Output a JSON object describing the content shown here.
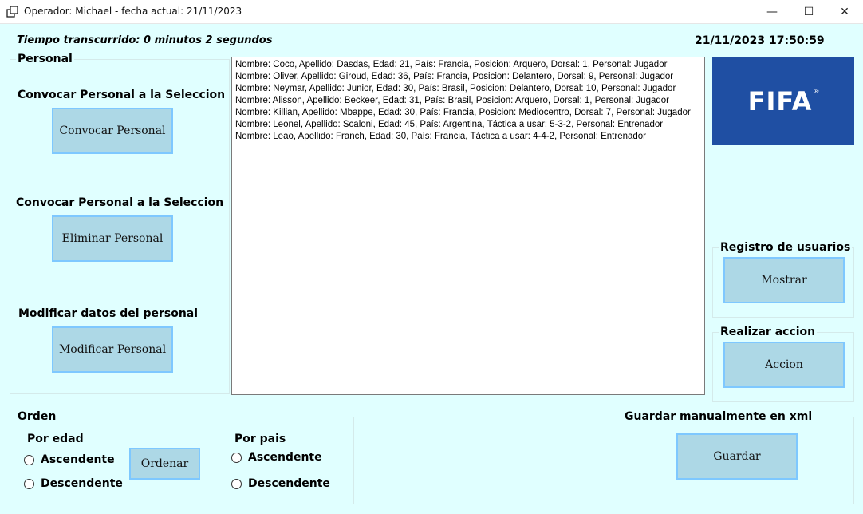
{
  "window": {
    "title": "Operador: Michael - fecha actual: 21/11/2023",
    "minimize": "—",
    "maximize": "☐",
    "close": "✕"
  },
  "header": {
    "elapsed": "Tiempo transcurrido: 0 minutos 2 segundos",
    "clock": "21/11/2023 17:50:59"
  },
  "personal": {
    "group_title": "Personal",
    "convocar_heading": "Convocar Personal a la Seleccion",
    "convocar_button": "Convocar Personal",
    "eliminar_heading": "Convocar Personal a la Seleccion",
    "eliminar_button": "Eliminar Personal",
    "modificar_heading": "Modificar datos del personal",
    "modificar_button": "Modificar Personal"
  },
  "list": {
    "items": [
      "Nombre: Coco, Apellido: Dasdas, Edad: 21, País: Francia, Posicion: Arquero, Dorsal: 1, Personal: Jugador",
      "Nombre: Oliver, Apellido: Giroud, Edad: 36, País: Francia, Posicion: Delantero, Dorsal: 9, Personal: Jugador",
      "Nombre: Neymar, Apellido: Junior, Edad: 30, País: Brasil, Posicion: Delantero, Dorsal: 10, Personal: Jugador",
      "Nombre: Alisson, Apellido: Beckeer, Edad: 31, País: Brasil, Posicion: Arquero, Dorsal: 1, Personal: Jugador",
      "Nombre: Killian, Apellido: Mbappe, Edad: 30, País: Francia, Posicion: Mediocentro, Dorsal: 7, Personal: Jugador",
      "Nombre: Leonel, Apellido: Scaloni, Edad: 45, País: Argentina, Táctica a usar: 5-3-2, Personal: Entrenador",
      "Nombre: Leao, Apellido: Franch, Edad: 30, País: Francia, Táctica a usar: 4-4-2, Personal: Entrenador"
    ]
  },
  "logo": {
    "text": "FIFA",
    "mark": "®",
    "bg": "#1f4fa3"
  },
  "registro": {
    "title": "Registro de usuarios",
    "button": "Mostrar"
  },
  "accion": {
    "title": "Realizar accion",
    "button": "Accion"
  },
  "orden": {
    "title": "Orden",
    "edad_label": "Por edad",
    "pais_label": "Por pais",
    "asc": "Ascendente",
    "desc": "Descendente",
    "button": "Ordenar"
  },
  "guardar": {
    "title": "Guardar manualmente en xml",
    "button": "Guardar"
  },
  "colors": {
    "background": "#e0ffff",
    "button": "#add8e6",
    "button_border": "#7ec8ff"
  }
}
